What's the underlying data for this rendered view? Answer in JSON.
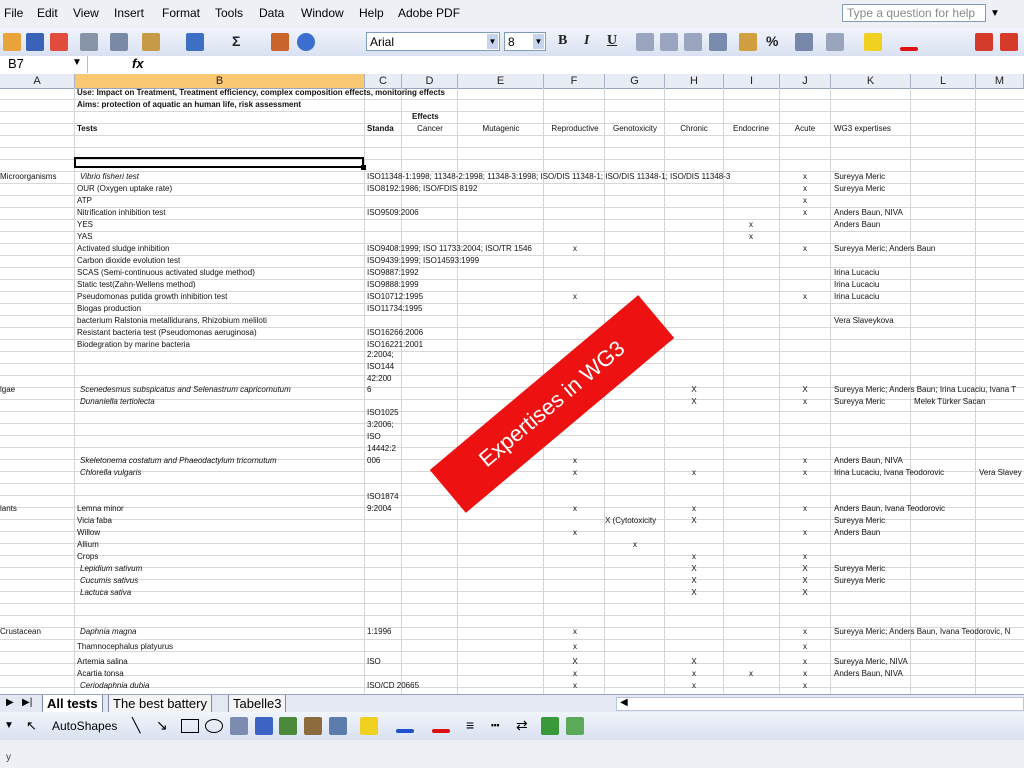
{
  "menu": [
    "File",
    "Edit",
    "View",
    "Insert",
    "Format",
    "Tools",
    "Data",
    "Window",
    "Help",
    "Adobe PDF"
  ],
  "help_box": {
    "placeholder": "Type a question for help"
  },
  "toolbar": {
    "font": "Arial",
    "size": "8",
    "bold": "B",
    "italic": "I",
    "underline": "U",
    "sum": "Σ",
    "percent": "%"
  },
  "formula_bar": {
    "name_box": "B7",
    "fx": "fx"
  },
  "columns": [
    "A",
    "B",
    "C",
    "D",
    "E",
    "F",
    "G",
    "H",
    "I",
    "J",
    "K",
    "L",
    "M"
  ],
  "header": {
    "use": "Use: Impact on Treatment, Treatment efficiency, complex composition effects, monitoring effects",
    "aims": "Aims: protection of aquatic an human life, risk assessment",
    "effects": "Effects",
    "tests": "Tests",
    "standards": "Standa",
    "cancer": "Cancer",
    "mutagenic": "Mutagenic",
    "reproductive": "Reproductive",
    "genotoxicity": "Genotoxicity",
    "chronic": "Chronic",
    "endocrine": "Endocrine",
    "acute": "Acute",
    "wg3": "WG3 expertises"
  },
  "groups": {
    "micro": "Microorganisms",
    "algae": "lgae",
    "plants": "lants",
    "crust": "Crustacean"
  },
  "rows": {
    "r1": {
      "test": "Vibrio fisheri  test",
      "std": "ISO11348-1:1998;  11348-2:1998; 11348-3:1998; ISO/DIS 11348-1; ISO/DIS 11348-1; ISO/DIS 11348-3",
      "acute": "x",
      "exp": "Sureyya Meric"
    },
    "r2": {
      "test": "OUR (Oxygen uptake rate)",
      "std": "ISO8192:1986; ISO/FDIS 8192",
      "acute": "x",
      "exp": "Sureyya Meric"
    },
    "r3": {
      "test": "ATP",
      "acute": "x"
    },
    "r4": {
      "test": "Nitrification inhibition test",
      "std": "ISO9509:2006",
      "acute": "x",
      "exp": "Anders Baun, NIVA"
    },
    "r5": {
      "test": "YES",
      "endo": "x",
      "exp": "Anders Baun"
    },
    "r6": {
      "test": "YAS",
      "endo": "x"
    },
    "r7": {
      "test": "Activated sludge inhibition",
      "std": "ISO9408:1999; ISO 11733:2004; ISO/TR 1546",
      "repro": "x",
      "acute": "x",
      "exp": "Sureyya Meric; Anders Baun"
    },
    "r8": {
      "test": "Carbon dioxide evolution test",
      "std": "ISO9439:1999; ISO14593:1999"
    },
    "r9": {
      "test": "SCAS (Semi-continuous activated sludge method)",
      "std": "ISO9887:1992",
      "exp": "Irina Lucaciu"
    },
    "r10": {
      "test": "Static test(Zahn-Wellens method)",
      "std": "ISO9888:1999",
      "exp": "Irina Lucaciu"
    },
    "r11": {
      "test": "Pseudomonas putida growth inhibition test",
      "std": "ISO10712:1995",
      "repro": "x",
      "acute": "x",
      "exp": "Irina Lucaciu"
    },
    "r12": {
      "test": "Biogas production",
      "std": "ISO11734:1995"
    },
    "r13": {
      "test": "bacterium Ralstonia metallidurans, Rhizobium meliloti",
      "exp": "Vera Slaveykova"
    },
    "r14": {
      "test": "Resistant bacteria test (Pseudomonas aeruginosa)",
      "std": "ISO16266:2006"
    },
    "r15": {
      "test": "Biodegration by marine bacteria",
      "std": "ISO16221:2001"
    },
    "r16": {
      "std1": "2:2004;",
      "std2": "ISO144",
      "std3": "42:200",
      "std4": "6",
      "test": "Scenedesmus subspicatus  and  Selenastrum capricornutum",
      "chronic": "X",
      "acute": "X",
      "exp": "Sureyya Meric; Anders Baun; Irina Lucaciu, Ivana T"
    },
    "r17": {
      "test": "Dunaniella tertiolecta",
      "chronic": "X",
      "acute": "x",
      "exp": "Sureyya Meric",
      "exp2": "Melek Türker Sacan"
    },
    "r18": {
      "std1": "ISO1025",
      "std2": "3:2006;",
      "std3": "ISO",
      "std4": "14442:2",
      "std5": "006",
      "test": "Skeletonema costatum  and  Phaeodactylum tricornutum",
      "repro": "x",
      "acute": "x",
      "exp": "Anders Baun, NIVA"
    },
    "r19": {
      "test": "Chlorella vulgaris",
      "repro": "x",
      "chronic": "x",
      "acute": "x",
      "exp": "Irina Lucaciu, Ivana Teodorovic",
      "exp2": "Vera Slavey"
    },
    "r20": {
      "std1": "ISO1874",
      "std2": "9:2004",
      "test": "Lemna minor",
      "repro": "x",
      "chronic": "x",
      "acute": "x",
      "exp": "Anders Baun, Ivana Teodorovic"
    },
    "r21": {
      "test": "Vicia faba",
      "geno": "X (Cytotoxicity",
      "chronic": "X",
      "exp": "Sureyya Meric"
    },
    "r22": {
      "test": "Willow",
      "repro": "x",
      "acute": "x",
      "exp": "Anders Baun"
    },
    "r23": {
      "test": "Allium",
      "geno": "x"
    },
    "r24": {
      "test": "Crops",
      "chronic": "x",
      "acute": "x"
    },
    "r25": {
      "test": "Lepidium sativum",
      "chronic": "X",
      "acute": "X",
      "exp": "Sureyya Meric"
    },
    "r26": {
      "test": "Cucumis sativus",
      "chronic": "X",
      "acute": "X",
      "exp": "Sureyya Meric"
    },
    "r27": {
      "test": "Lactuca sativa",
      "chronic": "X",
      "acute": "X"
    },
    "r28": {
      "test": "Daphnia magna",
      "std": "1:1996",
      "repro": "x",
      "acute": "x",
      "exp": "Sureyya Meric; Anders Baun, Ivana Teodorovic, N"
    },
    "r29": {
      "test": "Thamnocephalus platyurus",
      "repro": "x",
      "acute": "x"
    },
    "r30": {
      "test": "Artemia salina",
      "std": "ISO",
      "repro": "X",
      "chronic": "X",
      "acute": "x",
      "exp": "Sureyya Meric, NIVA"
    },
    "r31": {
      "test": "Acartia tonsa",
      "repro": "x",
      "chronic": "x",
      "endo": "x",
      "acute": "x",
      "exp": "Anders Baun, NIVA"
    },
    "r32": {
      "test": "Ceriodaphnia dubia",
      "std": "ISO/CD 20665",
      "repro": "x",
      "chronic": "x",
      "acute": "x"
    }
  },
  "stamp": "Expertises in WG3",
  "sheet_tabs": [
    "All tests",
    "The best battery",
    "Tabelle3"
  ],
  "drawing": {
    "autoshapes": "AutoShapes"
  },
  "status": "y"
}
